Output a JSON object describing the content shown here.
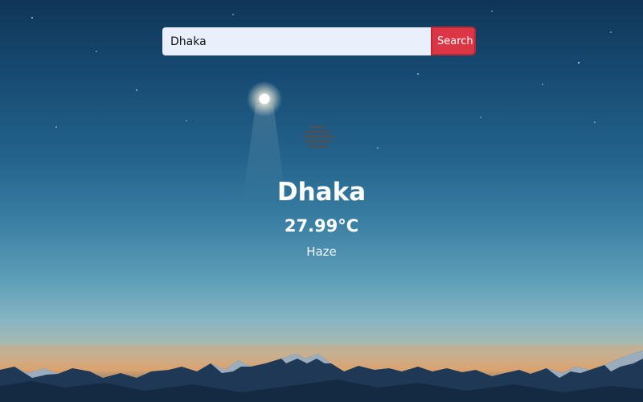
{
  "search": {
    "value": "Dhaka",
    "button_label": "Search"
  },
  "weather": {
    "city": "Dhaka",
    "temperature": "27.99°C",
    "condition": "Haze",
    "icon": "haze-icon"
  },
  "colors": {
    "accent": "#dc3545",
    "input_bg": "#e9f0fb",
    "text": "#ffffff"
  }
}
